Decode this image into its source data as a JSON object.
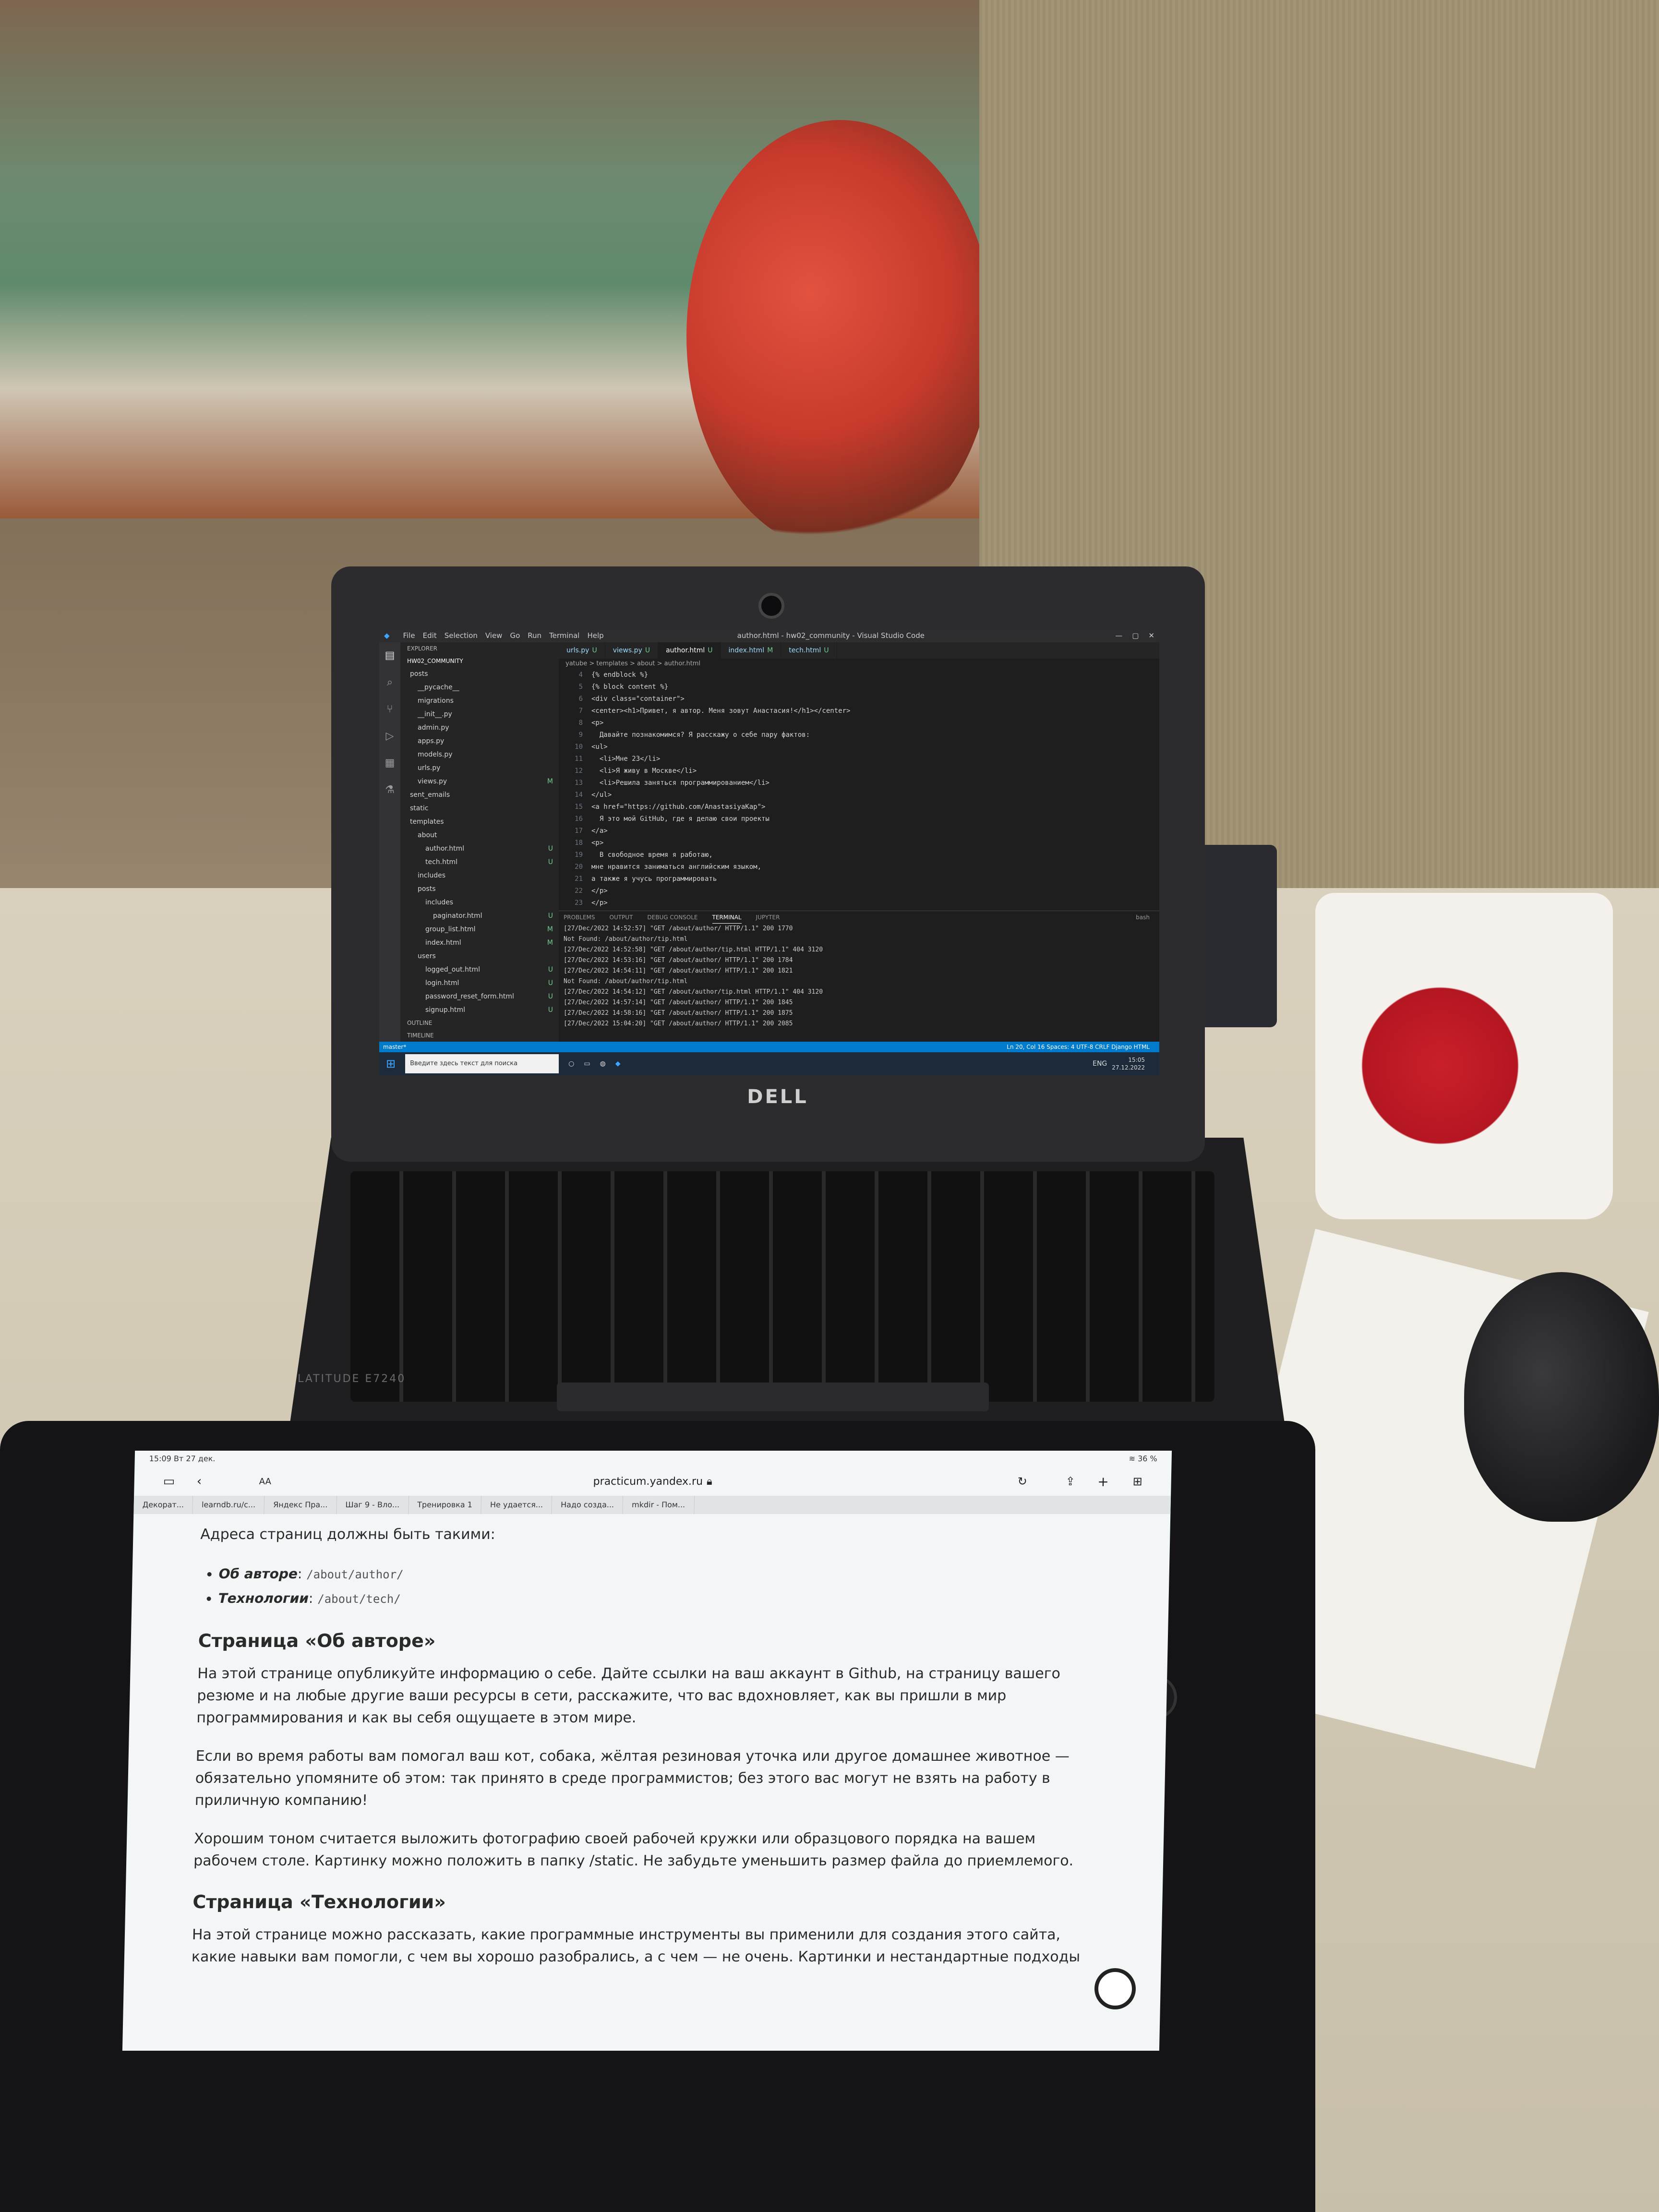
{
  "vscode": {
    "menu": [
      "File",
      "Edit",
      "Selection",
      "View",
      "Go",
      "Run",
      "Terminal",
      "Help"
    ],
    "window_title": "author.html - hw02_community - Visual Studio Code",
    "explorer_label": "EXPLORER",
    "project": "HW02_COMMUNITY",
    "tree": [
      {
        "label": "posts",
        "badge": ""
      },
      {
        "label": "__pycache__",
        "badge": ""
      },
      {
        "label": "migrations",
        "badge": ""
      },
      {
        "label": "__init__.py",
        "badge": ""
      },
      {
        "label": "admin.py",
        "badge": ""
      },
      {
        "label": "apps.py",
        "badge": ""
      },
      {
        "label": "models.py",
        "badge": ""
      },
      {
        "label": "urls.py",
        "badge": ""
      },
      {
        "label": "views.py",
        "badge": "M"
      },
      {
        "label": "sent_emails",
        "badge": ""
      },
      {
        "label": "static",
        "badge": ""
      },
      {
        "label": "templates",
        "badge": ""
      },
      {
        "label": "about",
        "badge": ""
      },
      {
        "label": "author.html",
        "badge": "U"
      },
      {
        "label": "tech.html",
        "badge": "U"
      },
      {
        "label": "includes",
        "badge": ""
      },
      {
        "label": "posts",
        "badge": ""
      },
      {
        "label": "includes",
        "badge": ""
      },
      {
        "label": "paginator.html",
        "badge": "U"
      },
      {
        "label": "group_list.html",
        "badge": "M"
      },
      {
        "label": "index.html",
        "badge": "M"
      },
      {
        "label": "users",
        "badge": ""
      },
      {
        "label": "logged_out.html",
        "badge": "U"
      },
      {
        "label": "login.html",
        "badge": "U"
      },
      {
        "label": "password_reset_form.html",
        "badge": "U"
      },
      {
        "label": "signup.html",
        "badge": "U"
      }
    ],
    "outline": "OUTLINE",
    "timeline": "TIMELINE",
    "tabs": [
      {
        "label": "urls.py",
        "status": "U"
      },
      {
        "label": "views.py",
        "status": "U"
      },
      {
        "label": "author.html",
        "status": "U"
      },
      {
        "label": "index.html",
        "status": "M"
      },
      {
        "label": "tech.html",
        "status": "U"
      }
    ],
    "breadcrumb": "yatube > templates > about > author.html",
    "code": [
      {
        "n": "4",
        "t": "{% endblock %}"
      },
      {
        "n": "5",
        "t": "{% block content %}"
      },
      {
        "n": "6",
        "t": "<div class=\"container\">"
      },
      {
        "n": "7",
        "t": "<center><h1>Привет, я автор. Меня зовут Анастасия!</h1></center>"
      },
      {
        "n": "8",
        "t": "<p>"
      },
      {
        "n": "9",
        "t": "  Давайте познакомимся? Я расскажу о себе пару фактов:"
      },
      {
        "n": "10",
        "t": "<ul>"
      },
      {
        "n": "11",
        "t": "  <li>Мне 23</li>"
      },
      {
        "n": "12",
        "t": "  <li>Я живу в Москве</li>"
      },
      {
        "n": "13",
        "t": "  <li>Решила заняться программированием</li>"
      },
      {
        "n": "14",
        "t": "</ul>"
      },
      {
        "n": "15",
        "t": "<a href=\"https://github.com/AnastasiyaKap\">"
      },
      {
        "n": "16",
        "t": "  Я это мой GitHub, где я делаю свои проекты"
      },
      {
        "n": "17",
        "t": "</a>"
      },
      {
        "n": "18",
        "t": "<p>"
      },
      {
        "n": "19",
        "t": "  В свободное время я работаю,"
      },
      {
        "n": "20",
        "t": "мне нравится заниматься английским языком,"
      },
      {
        "n": "21",
        "t": "а также я учусь программировать"
      },
      {
        "n": "22",
        "t": "</p>"
      },
      {
        "n": "23",
        "t": "</p>"
      }
    ],
    "panel_tabs": [
      "PROBLEMS",
      "OUTPUT",
      "DEBUG CONSOLE",
      "TERMINAL",
      "JUPYTER"
    ],
    "panel_active": "TERMINAL",
    "terminal_label": "bash",
    "terminal": [
      "[27/Dec/2022 14:52:57] \"GET /about/author/ HTTP/1.1\" 200 1770",
      "Not Found: /about/author/tip.html",
      "[27/Dec/2022 14:52:58] \"GET /about/author/tip.html HTTP/1.1\" 404 3120",
      "[27/Dec/2022 14:53:16] \"GET /about/author/ HTTP/1.1\" 200 1784",
      "[27/Dec/2022 14:54:11] \"GET /about/author/ HTTP/1.1\" 200 1821",
      "Not Found: /about/author/tip.html",
      "[27/Dec/2022 14:54:12] \"GET /about/author/tip.html HTTP/1.1\" 404 3120",
      "[27/Dec/2022 14:57:14] \"GET /about/author/ HTTP/1.1\" 200 1845",
      "[27/Dec/2022 14:58:16] \"GET /about/author/ HTTP/1.1\" 200 1875",
      "[27/Dec/2022 15:04:20] \"GET /about/author/ HTTP/1.1\" 200 2085"
    ],
    "status_left": "master*",
    "status_right": "Ln 20, Col 16   Spaces: 4   UTF-8   CRLF   Django HTML",
    "taskbar_search": "Введите здесь текст для поиска",
    "taskbar_lang": "ENG",
    "clock_time": "15:05",
    "clock_date": "27.12.2022"
  },
  "laptop": {
    "brand": "DELL",
    "model": "LATITUDE E7240"
  },
  "tablet": {
    "time": "15:09",
    "date": "Вт 27 дек.",
    "battery": "36 %",
    "url": "practicum.yandex.ru",
    "text_size": "AA",
    "tabs": [
      "Декорат...",
      "learndb.ru/c...",
      "Яндекс Пра...",
      "Шаг 9 - Вло...",
      "Тренировка 1",
      "Не удается...",
      "Надо созда...",
      "mkdir - Пом..."
    ],
    "intro": "Адреса страниц должны быть такими:",
    "addresses": [
      {
        "label": "Об авторе",
        "path": "/about/author/"
      },
      {
        "label": "Технологии",
        "path": "/about/tech/"
      }
    ],
    "h_author": "Страница «Об авторе»",
    "p1": "На этой странице опубликуйте информацию о себе. Дайте ссылки на ваш аккаунт в Github, на страницу вашего резюме и на любые другие ваши ресурсы в сети, расскажите, что вас вдохновляет, как вы пришли в мир программирования и как вы себя ощущаете в этом мире.",
    "p2": "Если во время работы вам помогал ваш кот, собака, жёлтая резиновая уточка или другое домашнее животное — обязательно упомяните об этом: так принято в среде программистов; без этого вас могут не взять на работу в приличную компанию!",
    "p3": "Хорошим тоном считается выложить фотографию своей рабочей кружки или образцового порядка на вашем рабочем столе. Картинку можно положить в папку /static. Не забудьте уменьшить размер файла до приемлемого.",
    "h_tech": "Страница «Технологии»",
    "p4": "На этой странице можно рассказать, какие программные инструменты вы применили для создания этого сайта, какие навыки вам помогли, с чем вы хорошо разобрались, а с чем — не очень. Картинки и нестандартные подходы"
  }
}
